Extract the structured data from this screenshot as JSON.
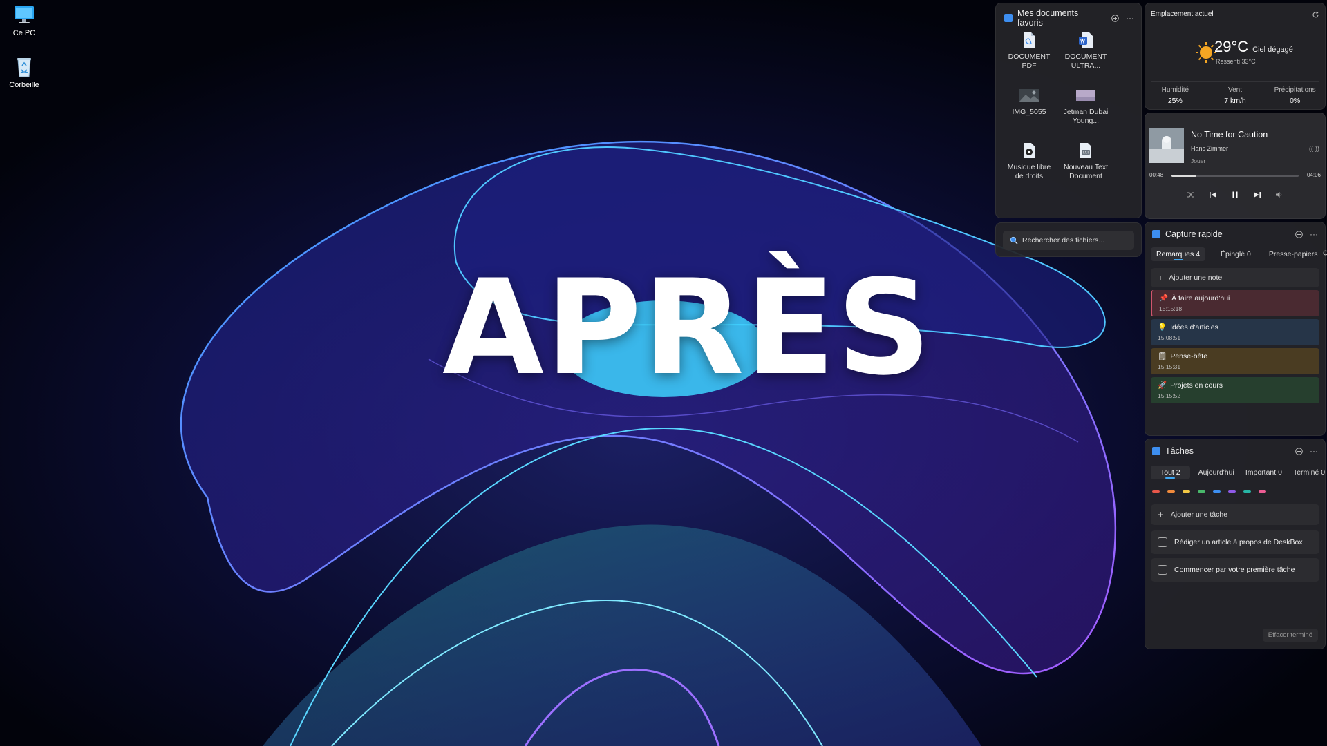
{
  "desktop": {
    "icons": [
      {
        "label": "Ce PC"
      },
      {
        "label": "Corbeille"
      }
    ]
  },
  "overlay": {
    "title": "APRÈS"
  },
  "documents": {
    "title": "Mes documents favoris",
    "files": [
      {
        "name": "DOCUMENT PDF",
        "icon": "pdf-file-icon"
      },
      {
        "name": "DOCUMENT ULTRA...",
        "icon": "word-file-icon"
      },
      {
        "name": "IMG_5055",
        "icon": "image-file-icon"
      },
      {
        "name": "Jetman Dubai Young...",
        "icon": "video-file-icon"
      },
      {
        "name": "Musique libre de droits",
        "icon": "audio-file-icon"
      },
      {
        "name": "Nouveau Text Document",
        "icon": "text-file-icon"
      }
    ],
    "search_placeholder": "Rechercher des fichiers..."
  },
  "weather": {
    "title": "Emplacement actuel",
    "temperature": "29°C",
    "condition": "Ciel dégagé",
    "feels_like": "Ressenti 33°C",
    "stats": [
      {
        "label": "Humidité",
        "value": "25%"
      },
      {
        "label": "Vent",
        "value": "7 km/h"
      },
      {
        "label": "Précipitations",
        "value": "0%"
      }
    ]
  },
  "music": {
    "title": "No Time for Caution",
    "artist": "Hans Zimmer",
    "status": "Jouer",
    "elapsed": "00:48",
    "duration": "04:06",
    "progress": 0.195
  },
  "capture": {
    "title": "Capture rapide",
    "tabs": [
      "Remarques 4",
      "Épinglé 0",
      "Presse-papiers"
    ],
    "add_note": "Ajouter une note",
    "notes": [
      {
        "title": "À faire aujourd'hui",
        "time": "15:15:18",
        "color": "#4a2a31",
        "icon": "📌"
      },
      {
        "title": "Idées d'articles",
        "time": "15:08:51",
        "color": "#263548",
        "icon": "💡"
      },
      {
        "title": "Pense-bête",
        "time": "15:15:31",
        "color": "#4a3c22",
        "icon": "🗒"
      },
      {
        "title": "Projets en cours",
        "time": "15:15:52",
        "color": "#263f2e",
        "icon": "🚀"
      }
    ]
  },
  "tasks": {
    "title": "Tâches",
    "tabs": [
      "Tout 2",
      "Aujourd'hui",
      "Important 0",
      "Terminé 0"
    ],
    "colors": [
      "#e8574a",
      "#f08a3c",
      "#f2c744",
      "#49b86b",
      "#3d8ef0",
      "#8f5ae8",
      "#27b5a5",
      "#ec5c93"
    ],
    "add_task": "Ajouter une tâche",
    "items": [
      {
        "label": "Rédiger un article à propos de DeskBox"
      },
      {
        "label": "Commencer par votre première tâche"
      }
    ],
    "clear_done": "Effacer terminé"
  }
}
